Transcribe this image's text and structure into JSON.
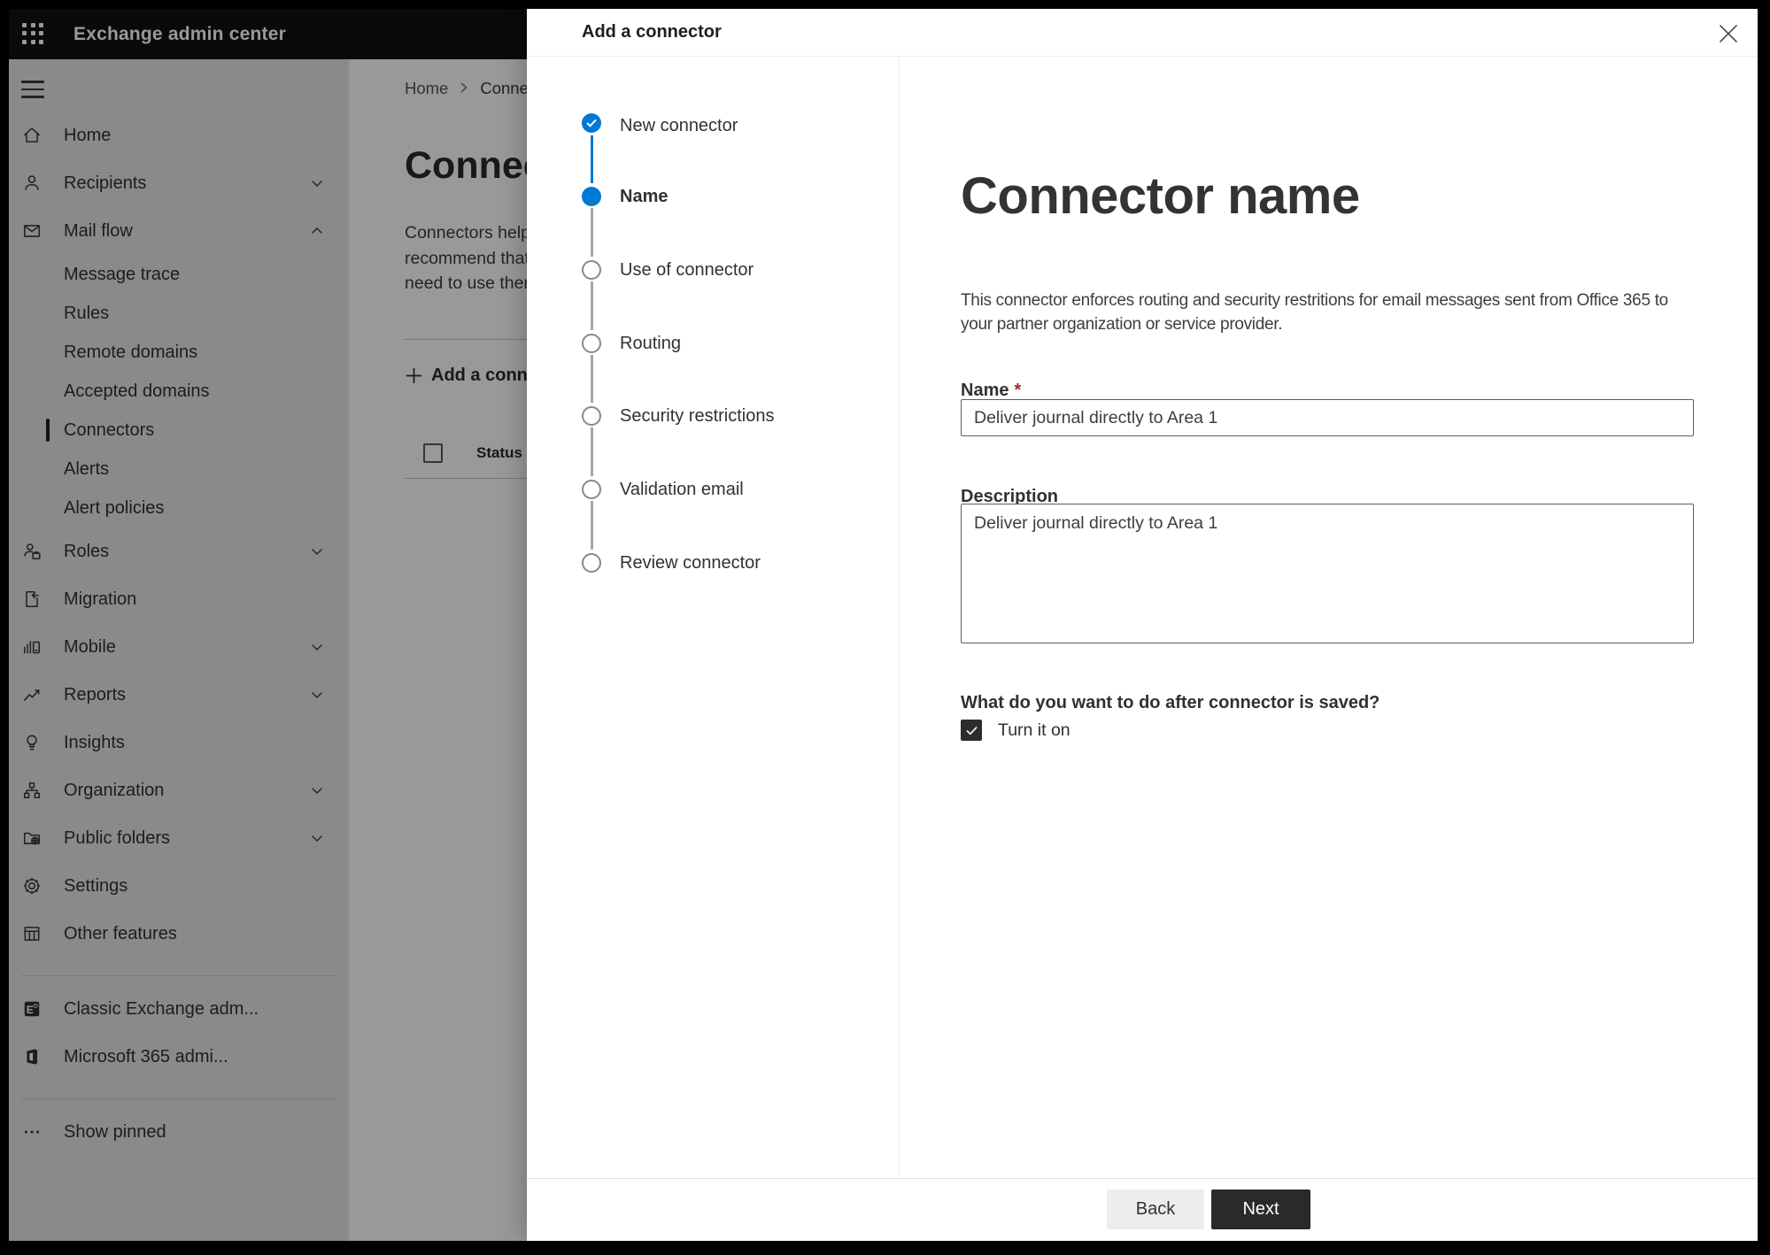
{
  "colors": {
    "accent": "#0078d4",
    "appbar": "#111111",
    "overlay": "rgba(0,0,0,0.40)",
    "next_button": "#2b2a29",
    "back_button": "#efedec",
    "required_marker_color": "#a4262c",
    "selected_indicator": "#201f1e"
  },
  "app": {
    "title": "Exchange admin center"
  },
  "sidebar": {
    "items": [
      {
        "label": "Home",
        "icon": "home-icon",
        "chevron": null
      },
      {
        "label": "Recipients",
        "icon": "person-icon",
        "chevron": "down"
      },
      {
        "label": "Mail flow",
        "icon": "mail-icon",
        "chevron": "up",
        "expanded": true
      },
      {
        "label": "Roles",
        "icon": "roles-icon",
        "chevron": "down"
      },
      {
        "label": "Migration",
        "icon": "migration-icon",
        "chevron": null
      },
      {
        "label": "Mobile",
        "icon": "mobile-icon",
        "chevron": "down"
      },
      {
        "label": "Reports",
        "icon": "reports-icon",
        "chevron": "down"
      },
      {
        "label": "Insights",
        "icon": "insights-icon",
        "chevron": null
      },
      {
        "label": "Organization",
        "icon": "organization-icon",
        "chevron": "down"
      },
      {
        "label": "Public folders",
        "icon": "public-folders-icon",
        "chevron": "down"
      },
      {
        "label": "Settings",
        "icon": "settings-icon",
        "chevron": null
      },
      {
        "label": "Other features",
        "icon": "other-features-icon",
        "chevron": null
      }
    ],
    "mail_flow_children": [
      "Message trace",
      "Rules",
      "Remote domains",
      "Accepted domains",
      "Connectors",
      "Alerts",
      "Alert policies"
    ],
    "selected_child": "Connectors",
    "footer_links": [
      "Classic Exchange adm...",
      "Microsoft 365 admi..."
    ],
    "show_pinned": "Show pinned"
  },
  "background_page": {
    "breadcrumb": {
      "home": "Home",
      "current": "Conne"
    },
    "title_fragment": "Connect",
    "intro_lines": [
      "Connectors help",
      "recommend that",
      "need to use ther"
    ],
    "add_button_label": "Add a conn",
    "status_header": "Status"
  },
  "dialog": {
    "title": "Add a connector",
    "steps": [
      {
        "label": "New connector",
        "state": "completed"
      },
      {
        "label": "Name",
        "state": "current"
      },
      {
        "label": "Use of connector",
        "state": "upcoming"
      },
      {
        "label": "Routing",
        "state": "upcoming"
      },
      {
        "label": "Security restrictions",
        "state": "upcoming"
      },
      {
        "label": "Validation email",
        "state": "upcoming"
      },
      {
        "label": "Review connector",
        "state": "upcoming"
      }
    ],
    "page": {
      "heading": "Connector name",
      "description": "This connector enforces routing and security restritions for email messages sent from Office 365 to your partner organization or service provider.",
      "name_label": "Name",
      "required_marker": "*",
      "name_value": "Deliver journal directly to Area 1",
      "description_label": "Description",
      "description_value": "Deliver journal directly to Area 1",
      "after_save_question": "What do you want to do after connector is saved?",
      "turn_on_label": "Turn it on",
      "turn_on_checked": true
    },
    "footer": {
      "back_label": "Back",
      "next_label": "Next"
    }
  }
}
